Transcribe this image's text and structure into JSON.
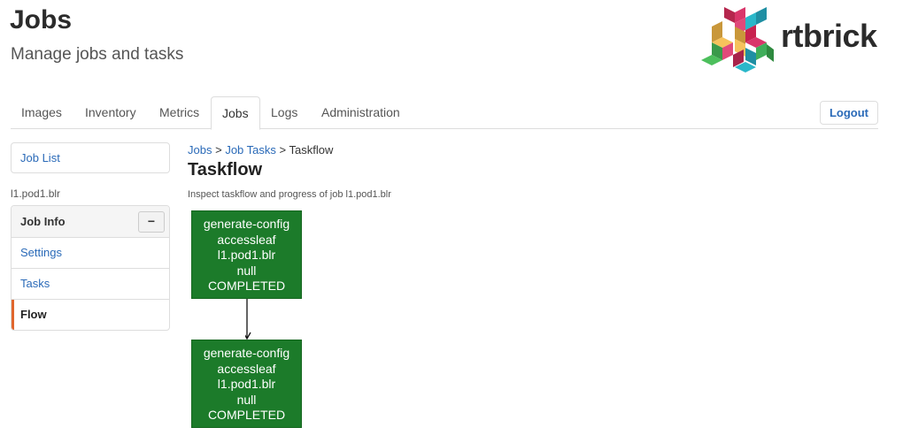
{
  "header": {
    "title": "Jobs",
    "subtitle": "Manage jobs and tasks",
    "brand": "rtbrick"
  },
  "nav": {
    "tabs": [
      {
        "label": "Images",
        "active": false
      },
      {
        "label": "Inventory",
        "active": false
      },
      {
        "label": "Metrics",
        "active": false
      },
      {
        "label": "Jobs",
        "active": true
      },
      {
        "label": "Logs",
        "active": false
      },
      {
        "label": "Administration",
        "active": false
      }
    ],
    "logout_label": "Logout"
  },
  "sidebar": {
    "job_list_label": "Job List",
    "job_name": "l1.pod1.blr",
    "panel_title": "Job Info",
    "collapse_symbol": "−",
    "items": [
      {
        "label": "Settings",
        "active": false
      },
      {
        "label": "Tasks",
        "active": false
      },
      {
        "label": "Flow",
        "active": true
      }
    ]
  },
  "main": {
    "breadcrumb": [
      {
        "label": "Jobs",
        "link": true
      },
      {
        "label": "Job Tasks",
        "link": true
      },
      {
        "label": "Taskflow",
        "link": false
      }
    ],
    "breadcrumb_separator": ">",
    "heading": "Taskflow",
    "description": "Inspect taskflow and progress of job l1.pod1.blr"
  },
  "flow": {
    "node_color": "#1c7b2a",
    "nodes": [
      {
        "lines": [
          "generate-config",
          "accessleaf",
          "l1.pod1.blr",
          "null",
          "COMPLETED"
        ]
      },
      {
        "lines": [
          "generate-config",
          "accessleaf",
          "l1.pod1.blr",
          "null",
          "COMPLETED"
        ]
      }
    ]
  },
  "colors": {
    "link": "#2a6ab8",
    "active_indicator": "#e0662d"
  }
}
